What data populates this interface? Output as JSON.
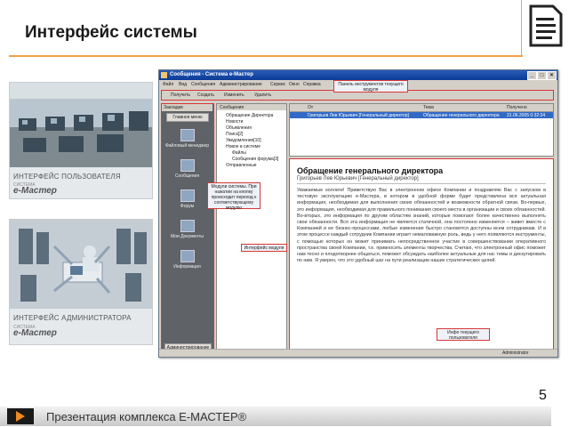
{
  "slide": {
    "title": "Интерфейс системы",
    "footer_text": "Презентация комплекса Е-МАСТЕР®",
    "page_number": "5",
    "doc_icon": "document-icon"
  },
  "thumbs": {
    "user": {
      "caption": "ИНТЕРФЕЙС ПОЛЬЗОВАТЕЛЯ",
      "brand_small": "СИСТЕМА",
      "brand": "e-Мастер"
    },
    "admin": {
      "caption": "ИНТЕРФЕЙС АДМИНИСТРАТОРА",
      "brand_small": "СИСТЕМА",
      "brand": "e-Мастер"
    }
  },
  "window": {
    "title": "Сообщения - Система е-Мастер",
    "menu": [
      "Файл",
      "Вид",
      "Сообщения",
      "Администрирование",
      "Сервис",
      "Окно",
      "Справка"
    ],
    "toolbar": [
      "Получить",
      "Создать",
      "Изменить",
      "Удалить"
    ],
    "sidebar": {
      "header": "Закладки",
      "main_button": "Главное меню",
      "items": [
        "Файловый менеджер",
        "Сообщения",
        "Форум",
        "Мои Документы",
        "Информация"
      ],
      "footer_button": "Администрирование"
    },
    "tree": {
      "root": "Сообщения",
      "nodes": [
        "Обращение Директора",
        "Новости",
        "Объявления",
        "Поиск[2]",
        "Уведомления[10]",
        "Новое в системе",
        "Файлы",
        "Сообщения форума[3]",
        "Отправленные"
      ]
    },
    "list": {
      "columns": [
        "От",
        "Тема",
        "Получено"
      ],
      "row": {
        "from": "Григорьев Лев Юрьевич [Генеральный директор]",
        "subject": "Обращение генерального директора",
        "received": "31.06.2005 0:32:34"
      }
    },
    "message": {
      "title": "Обращение генерального директора",
      "author": "Григорьев Лев Юрьевич [Генеральный директор]",
      "body": "Уважаемые коллеги! Приветствую Вас в электронном офисе Компании и поздравляю Вас с запуском в тестовую эксплуатацию е-Мастера, в котором в удобной форме будет представлена вся актуальная информация, необходимая для выполнения своих обязанностей и возможности обратной связи. Во-первых, это информация, необходимая для правильного понимания своего места в организации и своих обязанностей. Во-вторых, это информация по другим областям знаний, которые помогают более качественно выполнять свои обязанности. Вся эта информация не является статичной, она постоянно изменяется – живет вместе с Компанией и ее бизнес-процессами, любые изменения быстро становятся доступны всем сотрудникам. И в этом процессе каждый сотрудник Компании играет немаловажную роль, ведь у него появляются инструменты, с помощью которых он может принимать непосредственное участие в совершенствовании оперативного пространства своей Компании, т.е. привносить элементы творчества. Считаю, что электронный офис поможет нам тесно и плодотворнее общаться, поможет обсуждать наиболее актуальные для нас темы и дискутировать по ним. Я уверен, что это удобный шаг на пути реализации наших стратегических целей."
    },
    "status": "Administrator"
  },
  "callouts": {
    "toolbar": "Панель инструментов текущего модуля",
    "modules": "Модули системы. При нажатии на кнопку происходит переход к соответствующему модулю",
    "module_ui": "Интерфейс модуля",
    "user_info": "Инфо текущего пользователя"
  }
}
